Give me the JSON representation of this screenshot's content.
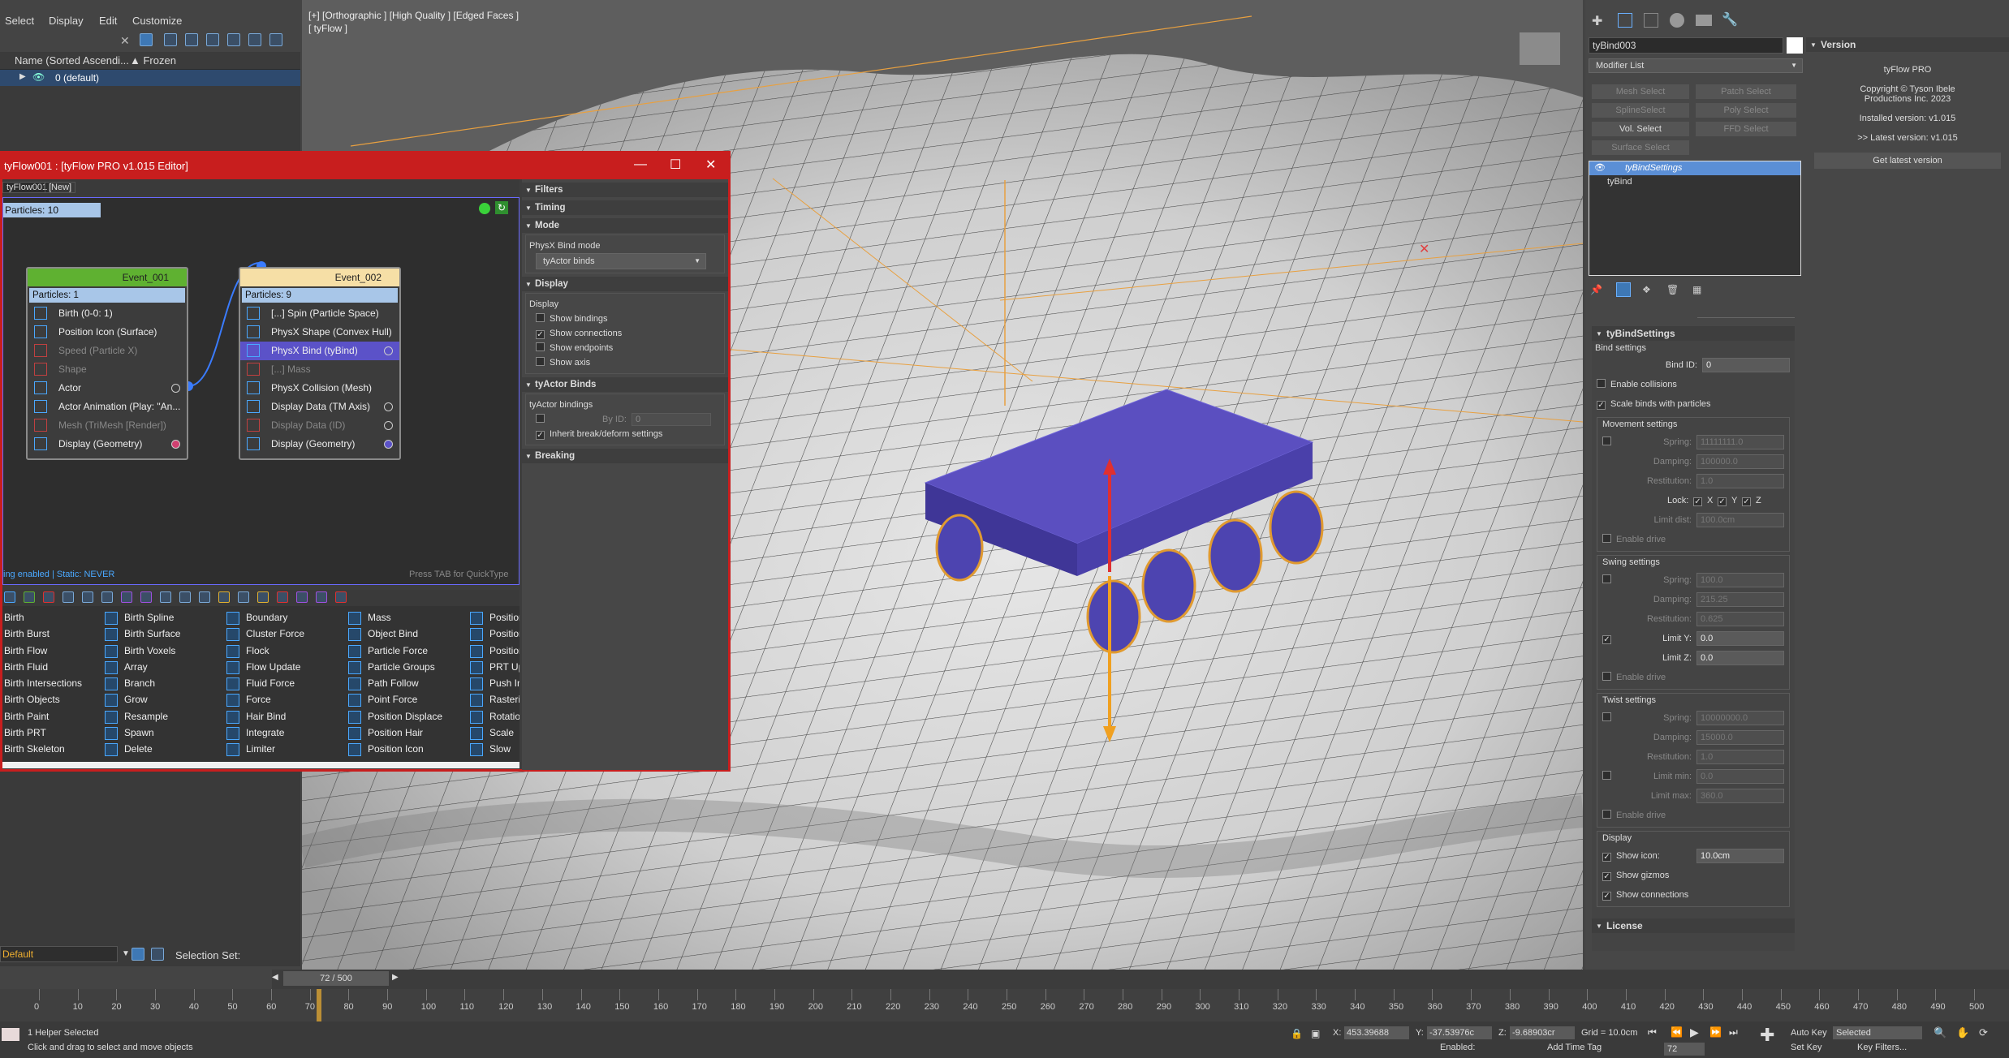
{
  "menu": {
    "items": [
      "Select",
      "Display",
      "Edit",
      "Customize"
    ]
  },
  "scene_explorer": {
    "col_name": "Name (Sorted Ascendi...",
    "col_frozen": "▲ Frozen",
    "row": "0 (default)",
    "layer": "Default",
    "selection_set": "Selection Set:"
  },
  "viewport": {
    "label": "[+] [Orthographic ] [High Quality ] [Edged Faces ]",
    "sublabel": "[ tyFlow ]"
  },
  "editor": {
    "title": "tyFlow001 : [tyFlow PRO v1.015 Editor]",
    "tabs": [
      "tyFlow001",
      "[New]"
    ],
    "particles_total": "Particles: 10",
    "status_left": "ing enabled | Static: NEVER",
    "status_right": "Press TAB for QuickType",
    "events": [
      {
        "name": "Event_001",
        "particles": "Particles: 1",
        "color": "#5fb131",
        "ops": [
          {
            "label": "Birth (0-0: 1)",
            "dim": false
          },
          {
            "label": "Position Icon (Surface)",
            "dim": false
          },
          {
            "label": "Speed (Particle X)",
            "dim": true
          },
          {
            "label": "Shape",
            "dim": true
          },
          {
            "label": "Actor",
            "dim": false
          },
          {
            "label": "Actor Animation (Play: \"An...",
            "dim": false
          },
          {
            "label": "Mesh (TriMesh [Render])",
            "dim": true
          },
          {
            "label": "Display (Geometry)",
            "dim": false
          }
        ]
      },
      {
        "name": "Event_002",
        "particles": "Particles: 9",
        "color": "#f6dfa6",
        "ops": [
          {
            "label": "[...] Spin (Particle Space)",
            "dim": false
          },
          {
            "label": "PhysX Shape (Convex Hull)",
            "dim": false
          },
          {
            "label": "PhysX Bind (tyBind)",
            "dim": false
          },
          {
            "label": "[...] Mass",
            "dim": true
          },
          {
            "label": "PhysX Collision (Mesh)",
            "dim": false
          },
          {
            "label": "Display Data (TM Axis)",
            "dim": false
          },
          {
            "label": "Display Data (ID)",
            "dim": true
          },
          {
            "label": "Display (Geometry)",
            "dim": false
          }
        ]
      }
    ],
    "rollouts": {
      "filters": "Filters",
      "timing": "Timing",
      "mode": "Mode",
      "bind_mode_label": "PhysX Bind mode",
      "bind_mode_value": "tyActor binds",
      "display": "Display",
      "display_sub": "Display",
      "show_bindings": "Show bindings",
      "show_connections": "Show connections",
      "show_endpoints": "Show endpoints",
      "show_axis": "Show axis",
      "actor_binds": "tyActor Binds",
      "actor_bindings": "tyActor bindings",
      "by_id": "By ID:",
      "by_id_val": "0",
      "inherit": "Inherit break/deform settings",
      "breaking": "Breaking"
    },
    "operators": {
      "col1": [
        "Birth",
        "Birth Burst",
        "Birth Flow",
        "Birth Fluid",
        "Birth Intersections",
        "Birth Objects",
        "Birth Paint",
        "Birth PRT",
        "Birth Skeleton"
      ],
      "col2": [
        "Birth Spline",
        "Birth Surface",
        "Birth Voxels",
        "Array",
        "Branch",
        "Grow",
        "Resample",
        "Spawn",
        "Delete"
      ],
      "col3": [
        "Boundary",
        "Cluster Force",
        "Flock",
        "Flow Update",
        "Fluid Force",
        "Force",
        "Hair Bind",
        "Integrate",
        "Limiter"
      ],
      "col4": [
        "Mass",
        "Object Bind",
        "Particle Force",
        "Particle Groups",
        "Path Follow",
        "Point Force",
        "Position Displace",
        "Position Hair",
        "Position Icon"
      ],
      "col5": [
        "Position",
        "Position",
        "Position",
        "PRT Up",
        "Push In",
        "Rasteriz",
        "Rotation",
        "Scale",
        "Slow"
      ]
    }
  },
  "command_panel": {
    "object_name": "tyBind003",
    "modifier_list": "Modifier List",
    "buttons": [
      "Mesh Select",
      "Patch Select",
      "SplineSelect",
      "Poly Select",
      "Vol. Select",
      "FFD Select",
      "Surface Select"
    ],
    "stack": [
      "tyBindSettings",
      "tyBind"
    ],
    "version": {
      "header": "Version",
      "product": "tyFlow PRO",
      "copyright": "Copyright © Tyson Ibele Productions Inc. 2023",
      "installed": "Installed version: v1.015",
      "latest": ">> Latest version: v1.015",
      "get_latest": "Get latest version"
    },
    "settings": {
      "header": "tyBindSettings",
      "bind_settings": "Bind settings",
      "bind_id_label": "Bind ID:",
      "bind_id": "0",
      "enable_collisions": "Enable collisions",
      "scale_binds": "Scale binds with particles",
      "movement": "Movement settings",
      "spring": "Spring:",
      "spring_val": "11111111.0",
      "damping": "Damping:",
      "damping_val": "100000.0",
      "restitution": "Restitution:",
      "restitution_val": "1.0",
      "lock": "Lock:",
      "lx": "X",
      "ly": "Y",
      "lz": "Z",
      "limit_dist": "Limit dist:",
      "limit_dist_val": "100.0cm",
      "enable_drive": "Enable drive",
      "swing": "Swing settings",
      "sw_spring_val": "100.0",
      "sw_damping_val": "215.25",
      "sw_rest_val": "0.625",
      "limit_y": "Limit Y:",
      "limit_y_val": "0.0",
      "limit_z": "Limit Z:",
      "limit_z_val": "0.0",
      "twist": "Twist settings",
      "tw_spring_val": "10000000.0",
      "tw_damping_val": "15000.0",
      "tw_rest_val": "1.0",
      "limit_min": "Limit min:",
      "limit_min_val": "0.0",
      "limit_max": "Limit max:",
      "limit_max_val": "360.0",
      "display": "Display",
      "show_icon": "Show icon:",
      "show_icon_val": "10.0cm",
      "show_gizmos": "Show gizmos",
      "show_connections": "Show connections",
      "license": "License"
    }
  },
  "timeline": {
    "frame": "72 / 500",
    "ticks": [
      "0",
      "10",
      "20",
      "30",
      "40",
      "50",
      "60",
      "70",
      "80",
      "90",
      "100",
      "110",
      "120",
      "130",
      "140",
      "150",
      "160",
      "170",
      "180",
      "190",
      "200",
      "210",
      "220",
      "230",
      "240",
      "250",
      "260",
      "270",
      "280",
      "290",
      "300",
      "310",
      "320",
      "330",
      "340",
      "350",
      "360",
      "370",
      "380",
      "390",
      "400",
      "410",
      "420",
      "430",
      "440",
      "450",
      "460",
      "470",
      "480",
      "490",
      "500"
    ]
  },
  "status": {
    "selected": "1 Helper Selected",
    "hint": "Click and drag to select and move objects",
    "x_label": "X:",
    "x": "453.39688",
    "y_label": "Y:",
    "y": "-37.53976c",
    "z_label": "Z:",
    "z": "-9.68903cr",
    "grid": "Grid = 10.0cm",
    "auto_key": "Auto Key",
    "selected_dd": "Selected",
    "set_key": "Set Key",
    "key_filters": "Key Filters...",
    "frame_val": "72",
    "enabled": "Enabled:",
    "add_time_tag": "Add Time Tag"
  }
}
